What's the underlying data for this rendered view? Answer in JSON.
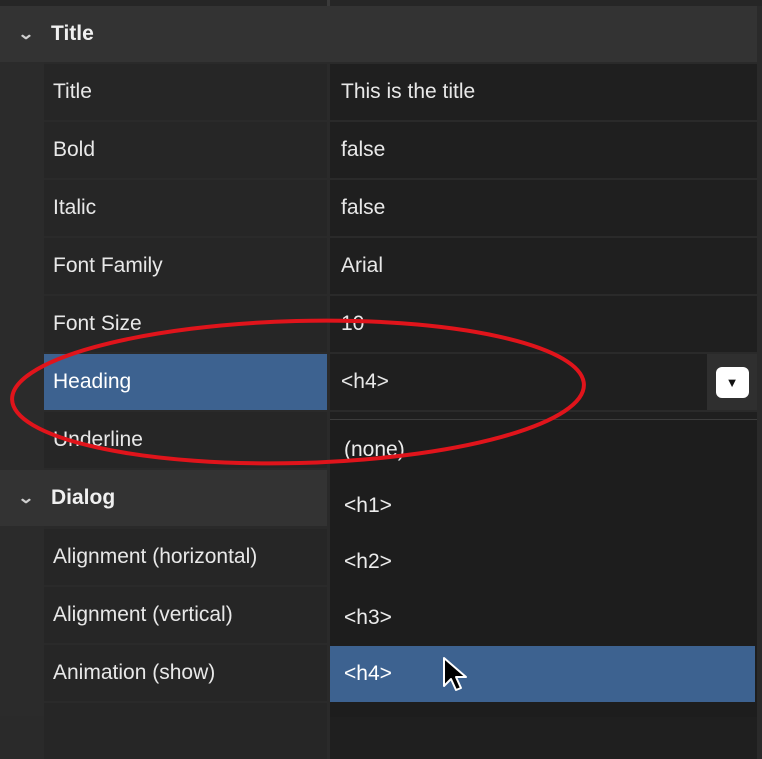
{
  "sections": {
    "title": {
      "label": "Title",
      "rows": [
        {
          "name": "Title",
          "value": "This is the title"
        },
        {
          "name": "Bold",
          "value": "false"
        },
        {
          "name": "Italic",
          "value": "false"
        },
        {
          "name": "Font Family",
          "value": "Arial"
        },
        {
          "name": "Font Size",
          "value": "10"
        },
        {
          "name": "Heading",
          "value": "<h4>"
        },
        {
          "name": "Underline",
          "value": ""
        }
      ]
    },
    "dialog": {
      "label": "Dialog",
      "rows": [
        {
          "name": "Alignment (horizontal)"
        },
        {
          "name": "Alignment (vertical)"
        },
        {
          "name": "Animation (show)"
        }
      ]
    }
  },
  "heading_dropdown": {
    "selected": "<h4>",
    "options": [
      "(none)",
      "<h1>",
      "<h2>",
      "<h3>",
      "<h4>"
    ]
  },
  "icons": {
    "section_toggle": "chevron-down-icon",
    "dropdown_toggle": "chevron-down-icon",
    "cursor": "mouse-pointer-icon"
  },
  "colors": {
    "selection": "#3d6290",
    "annotation": "#e0141b"
  }
}
